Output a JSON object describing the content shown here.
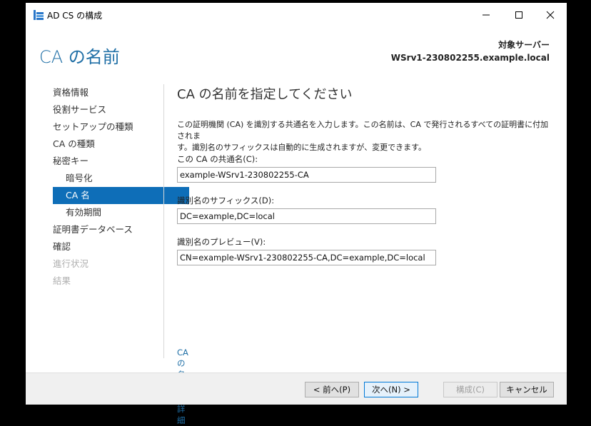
{
  "window": {
    "title": "AD CS の構成",
    "icons": {
      "app": "server-config-icon",
      "minimize": "minimize-icon",
      "maximize": "maximize-icon",
      "close": "close-icon"
    }
  },
  "header": {
    "page_title": "CA の名前",
    "target_label": "対象サーバー",
    "target_server": "WSrv1-230802255.example.local"
  },
  "nav": {
    "items": [
      {
        "label": "資格情報"
      },
      {
        "label": "役割サービス"
      },
      {
        "label": "セットアップの種類"
      },
      {
        "label": "CA の種類"
      },
      {
        "label": "秘密キー"
      },
      {
        "label": "暗号化"
      },
      {
        "label": "CA 名"
      },
      {
        "label": "有効期間"
      },
      {
        "label": "証明書データベース"
      },
      {
        "label": "確認"
      },
      {
        "label": "進行状況"
      },
      {
        "label": "結果"
      }
    ]
  },
  "content": {
    "title": "CA の名前を指定してください",
    "description_line1": "この証明機関 (CA) を識別する共通名を入力します。この名前は、CA で発行されるすべての証明書に付加されま",
    "description_line2": "す。識別名のサフィックスは自動的に生成されますが、変更できます。",
    "common_name_label": "この CA の共通名(C):",
    "common_name_value": "example-WSrv1-230802255-CA",
    "suffix_label": "識別名のサフィックス(D):",
    "suffix_value": "DC=example,DC=local",
    "preview_label": "識別名のプレビュー(V):",
    "preview_value": "CN=example-WSrv1-230802255-CA,DC=example,DC=local",
    "more_link": "CA の名前の詳細"
  },
  "buttons": {
    "back": "< 前へ(P)",
    "next": "次へ(N) >",
    "configure": "構成(C)",
    "cancel": "キャンセル"
  },
  "colors": {
    "accent": "#1f6fa6",
    "selected": "#0e6eb8"
  }
}
